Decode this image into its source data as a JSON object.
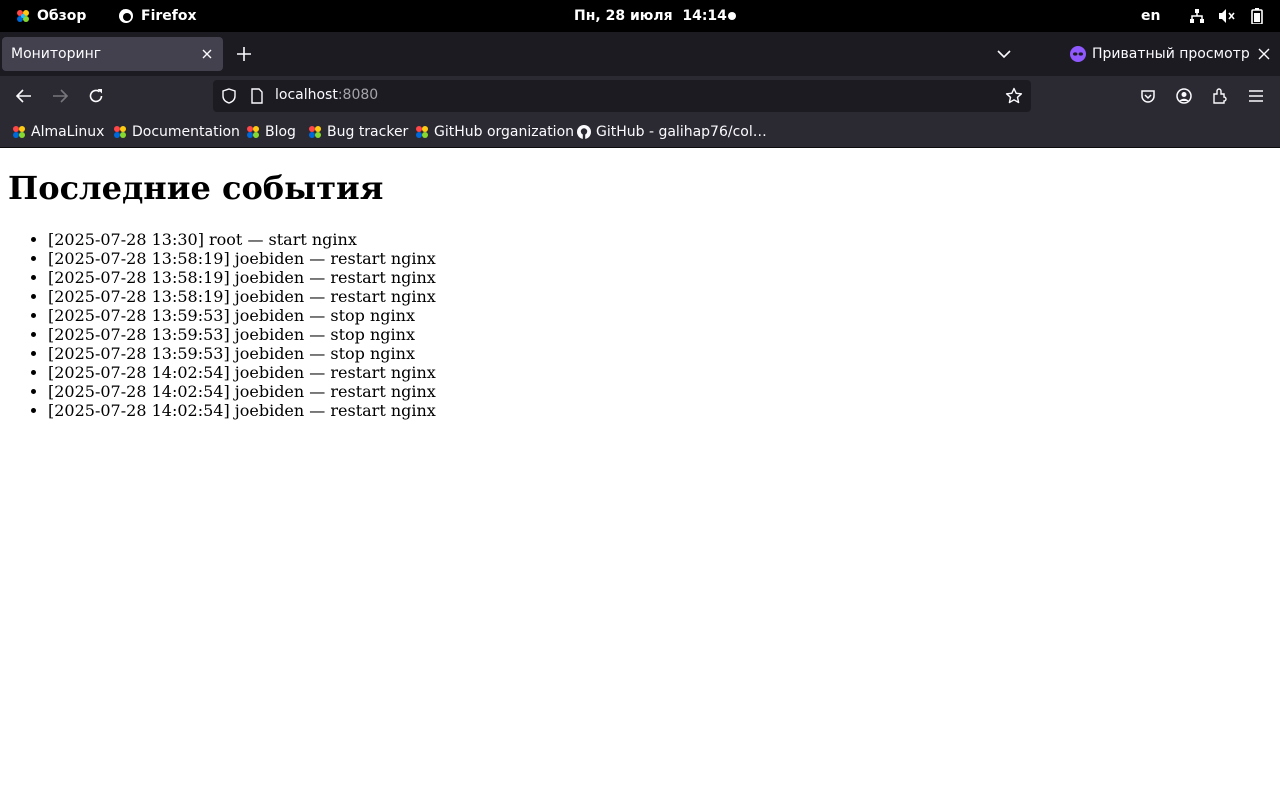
{
  "system_bar": {
    "activities_label": "Обзор",
    "app_label": "Firefox",
    "clock": "Пн, 28 июля  14:14",
    "language": "en",
    "tray_icons": [
      "network-icon",
      "volume-muted-icon",
      "battery-icon"
    ]
  },
  "browser": {
    "tab": {
      "title": "Мониторинг"
    },
    "private_label": "Приватный просмотр",
    "url": {
      "host": "localhost",
      "port": ":8080"
    },
    "bookmarks": [
      {
        "label": "AlmaLinux",
        "icon": "almalinux-icon"
      },
      {
        "label": "Documentation",
        "icon": "almalinux-icon"
      },
      {
        "label": "Blog",
        "icon": "almalinux-icon"
      },
      {
        "label": "Bug tracker",
        "icon": "almalinux-icon"
      },
      {
        "label": "GitHub organization",
        "icon": "almalinux-icon"
      },
      {
        "label": "GitHub - galihap76/col…",
        "icon": "github-icon"
      }
    ]
  },
  "page": {
    "heading": "Последние события",
    "events": [
      "[2025-07-28 13:30] root — start nginx",
      "[2025-07-28 13:58:19] joebiden — restart nginx",
      "[2025-07-28 13:58:19] joebiden — restart nginx",
      "[2025-07-28 13:58:19] joebiden — restart nginx",
      "[2025-07-28 13:59:53] joebiden — stop nginx",
      "[2025-07-28 13:59:53] joebiden — stop nginx",
      "[2025-07-28 13:59:53] joebiden — stop nginx",
      "[2025-07-28 14:02:54] joebiden — restart nginx",
      "[2025-07-28 14:02:54] joebiden — restart nginx",
      "[2025-07-28 14:02:54] joebiden — restart nginx"
    ]
  },
  "colors": {
    "system_bar_bg": "#000000",
    "tabstrip_bg": "#1c1b22",
    "toolbar_bg": "#2b2a33",
    "active_tab_bg": "#42414d",
    "private_accent": "#9059ff"
  }
}
